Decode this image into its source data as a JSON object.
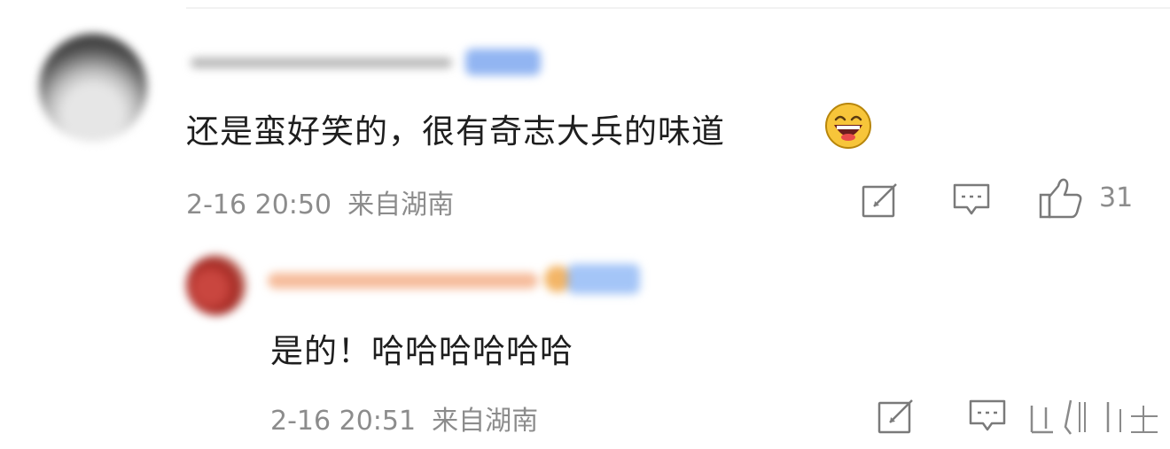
{
  "comments": {
    "main": {
      "text": "还是蛮好笑的，很有奇志大兵的味道",
      "emoji": "laughing-emoji",
      "time": "2-16 20:50",
      "location": "来自湖南",
      "likes": "31"
    },
    "reply": {
      "text": "是的！哈哈哈哈哈哈",
      "time": "2-16 20:51",
      "location": "来自湖南"
    }
  },
  "icons": {
    "share": "share-icon",
    "comment": "comment-icon",
    "like": "thumbs-up-icon"
  },
  "colors": {
    "text": "#1e1e1e",
    "meta": "#8c8c8c",
    "icon": "#7a7a7a"
  }
}
